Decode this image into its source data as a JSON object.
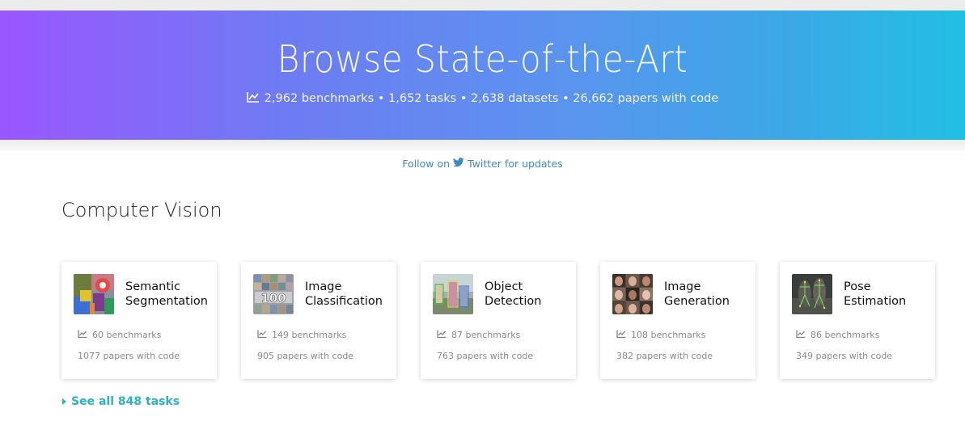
{
  "hero": {
    "title": "Browse State-of-the-Art",
    "stats": "2,962 benchmarks • 1,652 tasks • 2,638 datasets • 26,662 papers with code",
    "stats_icon": "chart-line-icon"
  },
  "follow": {
    "prefix": "Follow on",
    "icon": "twitter-icon",
    "link": "Twitter for updates"
  },
  "section": {
    "title": "Computer Vision"
  },
  "cards": [
    {
      "title": "Semantic Segmentation",
      "benchmarks": "60 benchmarks",
      "papers": "1077 papers with code"
    },
    {
      "title": "Image Classification",
      "benchmarks": "149 benchmarks",
      "papers": "905 papers with code"
    },
    {
      "title": "Object Detection",
      "benchmarks": "87 benchmarks",
      "papers": "763 papers with code"
    },
    {
      "title": "Image Generation",
      "benchmarks": "108 benchmarks",
      "papers": "382 papers with code"
    },
    {
      "title": "Pose Estimation",
      "benchmarks": "86 benchmarks",
      "papers": "349 papers with code"
    }
  ],
  "see_all": "See all 848 tasks",
  "colors": {
    "gradient_start": "#9a56ff",
    "gradient_end": "#22bfe3",
    "link": "#3d8ac2",
    "accent": "#27b4c3"
  }
}
